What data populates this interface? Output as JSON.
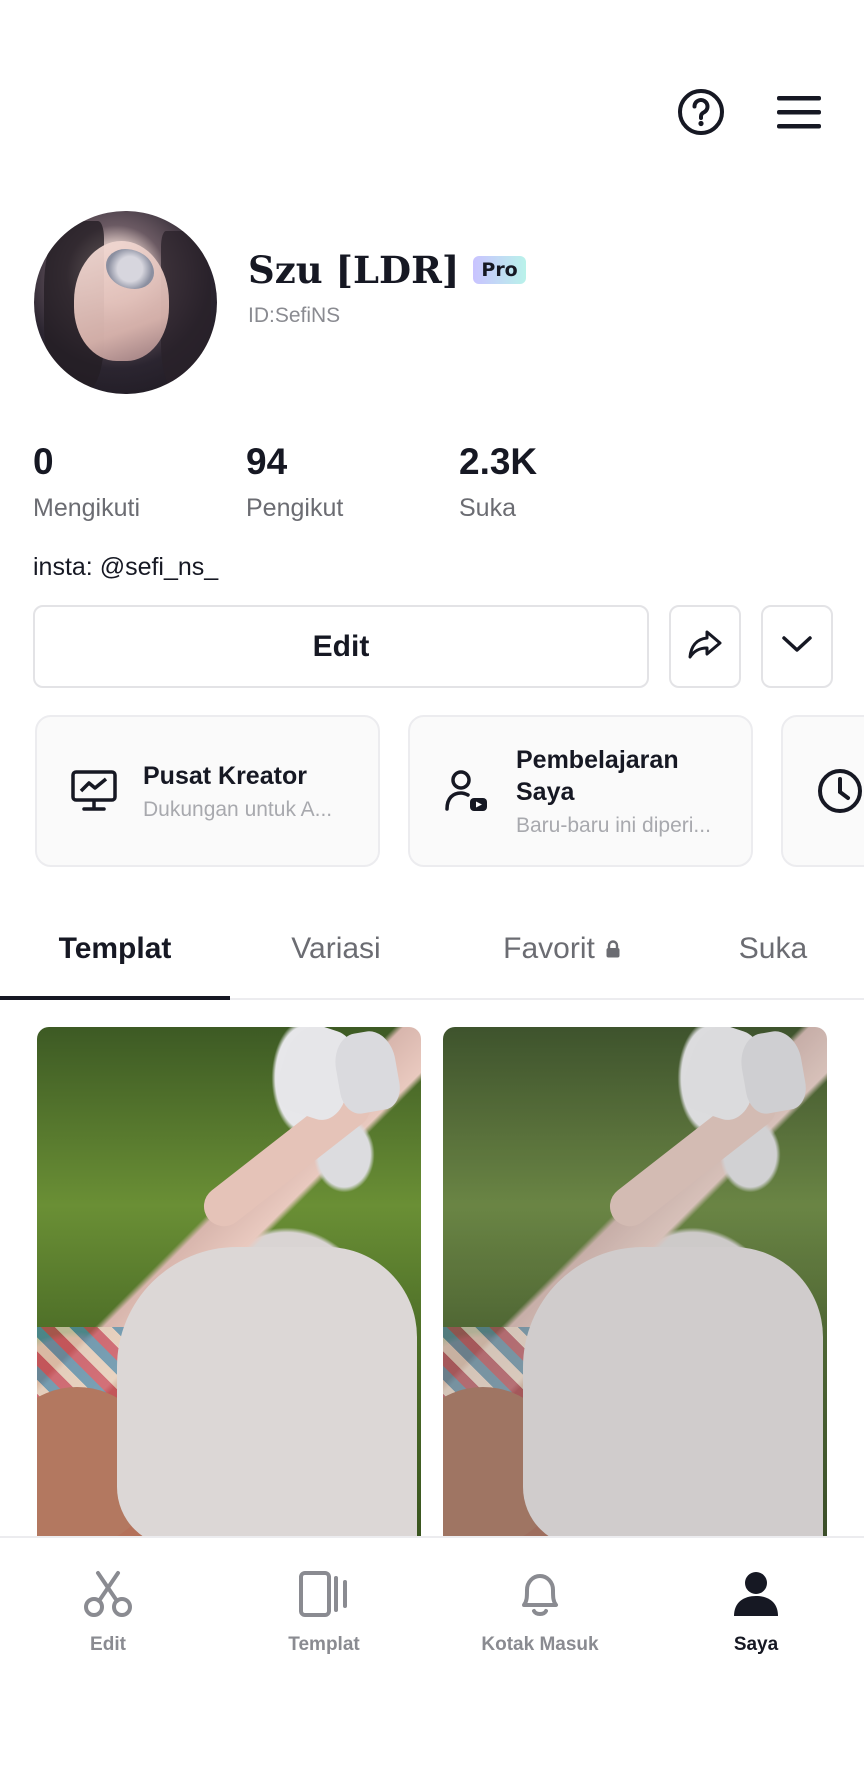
{
  "header": {
    "help_icon": "help-circle-icon",
    "menu_icon": "hamburger-menu-icon"
  },
  "profile": {
    "name": "Szu [LDR]",
    "badge": "Pro",
    "id": "ID:SefiNS",
    "bio": "insta: @sefi_ns_"
  },
  "stats": [
    {
      "value": "0",
      "label": "Mengikuti"
    },
    {
      "value": "94",
      "label": "Pengikut"
    },
    {
      "value": "2.3K",
      "label": "Suka"
    }
  ],
  "actions": {
    "edit_label": "Edit",
    "share_icon": "share-arrow-icon",
    "more_icon": "chevron-down-icon"
  },
  "cards": [
    {
      "title": "Pusat Kreator",
      "subtitle": "Dukungan untuk A...",
      "icon": "monitor-chart-icon"
    },
    {
      "title": "Pembelajaran Saya",
      "subtitle": "Baru-baru ini diperi...",
      "icon": "user-play-icon"
    },
    {
      "icon": "clock-icon"
    }
  ],
  "tabs": [
    {
      "label": "Templat",
      "active": true
    },
    {
      "label": "Variasi",
      "active": false
    },
    {
      "label": "Favorit",
      "active": false,
      "locked": true
    },
    {
      "label": "Suka",
      "active": false
    }
  ],
  "nav": [
    {
      "label": "Edit",
      "icon": "scissors-icon",
      "active": false
    },
    {
      "label": "Templat",
      "icon": "template-icon",
      "active": false
    },
    {
      "label": "Kotak Masuk",
      "icon": "bell-icon",
      "active": false
    },
    {
      "label": "Saya",
      "icon": "user-icon",
      "active": true
    }
  ],
  "colors": {
    "text": "#161823",
    "muted": "#6b6c72",
    "border": "#e3e3e6",
    "pro_gradient_start": "#c9c3ff",
    "pro_gradient_end": "#b9f2ea"
  }
}
